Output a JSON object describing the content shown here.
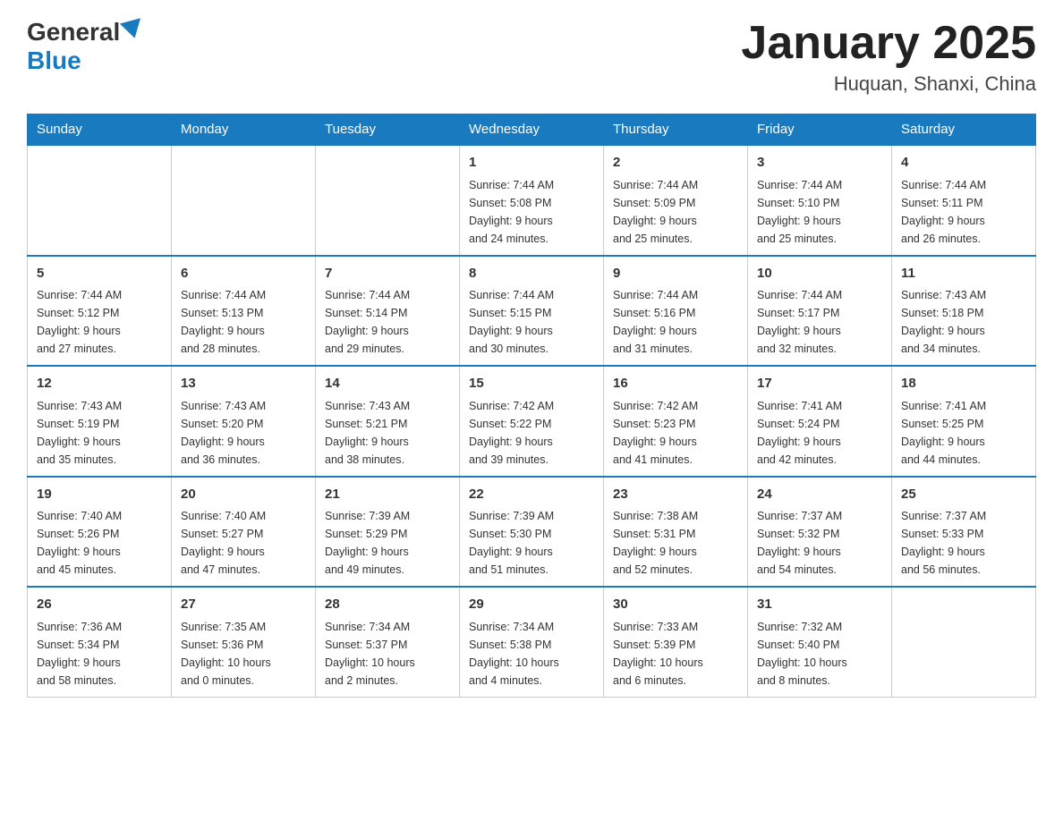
{
  "header": {
    "logo_general": "General",
    "logo_blue": "Blue",
    "month_title": "January 2025",
    "location": "Huquan, Shanxi, China"
  },
  "days_of_week": [
    "Sunday",
    "Monday",
    "Tuesday",
    "Wednesday",
    "Thursday",
    "Friday",
    "Saturday"
  ],
  "weeks": [
    [
      {
        "day": "",
        "info": ""
      },
      {
        "day": "",
        "info": ""
      },
      {
        "day": "",
        "info": ""
      },
      {
        "day": "1",
        "info": "Sunrise: 7:44 AM\nSunset: 5:08 PM\nDaylight: 9 hours\nand 24 minutes."
      },
      {
        "day": "2",
        "info": "Sunrise: 7:44 AM\nSunset: 5:09 PM\nDaylight: 9 hours\nand 25 minutes."
      },
      {
        "day": "3",
        "info": "Sunrise: 7:44 AM\nSunset: 5:10 PM\nDaylight: 9 hours\nand 25 minutes."
      },
      {
        "day": "4",
        "info": "Sunrise: 7:44 AM\nSunset: 5:11 PM\nDaylight: 9 hours\nand 26 minutes."
      }
    ],
    [
      {
        "day": "5",
        "info": "Sunrise: 7:44 AM\nSunset: 5:12 PM\nDaylight: 9 hours\nand 27 minutes."
      },
      {
        "day": "6",
        "info": "Sunrise: 7:44 AM\nSunset: 5:13 PM\nDaylight: 9 hours\nand 28 minutes."
      },
      {
        "day": "7",
        "info": "Sunrise: 7:44 AM\nSunset: 5:14 PM\nDaylight: 9 hours\nand 29 minutes."
      },
      {
        "day": "8",
        "info": "Sunrise: 7:44 AM\nSunset: 5:15 PM\nDaylight: 9 hours\nand 30 minutes."
      },
      {
        "day": "9",
        "info": "Sunrise: 7:44 AM\nSunset: 5:16 PM\nDaylight: 9 hours\nand 31 minutes."
      },
      {
        "day": "10",
        "info": "Sunrise: 7:44 AM\nSunset: 5:17 PM\nDaylight: 9 hours\nand 32 minutes."
      },
      {
        "day": "11",
        "info": "Sunrise: 7:43 AM\nSunset: 5:18 PM\nDaylight: 9 hours\nand 34 minutes."
      }
    ],
    [
      {
        "day": "12",
        "info": "Sunrise: 7:43 AM\nSunset: 5:19 PM\nDaylight: 9 hours\nand 35 minutes."
      },
      {
        "day": "13",
        "info": "Sunrise: 7:43 AM\nSunset: 5:20 PM\nDaylight: 9 hours\nand 36 minutes."
      },
      {
        "day": "14",
        "info": "Sunrise: 7:43 AM\nSunset: 5:21 PM\nDaylight: 9 hours\nand 38 minutes."
      },
      {
        "day": "15",
        "info": "Sunrise: 7:42 AM\nSunset: 5:22 PM\nDaylight: 9 hours\nand 39 minutes."
      },
      {
        "day": "16",
        "info": "Sunrise: 7:42 AM\nSunset: 5:23 PM\nDaylight: 9 hours\nand 41 minutes."
      },
      {
        "day": "17",
        "info": "Sunrise: 7:41 AM\nSunset: 5:24 PM\nDaylight: 9 hours\nand 42 minutes."
      },
      {
        "day": "18",
        "info": "Sunrise: 7:41 AM\nSunset: 5:25 PM\nDaylight: 9 hours\nand 44 minutes."
      }
    ],
    [
      {
        "day": "19",
        "info": "Sunrise: 7:40 AM\nSunset: 5:26 PM\nDaylight: 9 hours\nand 45 minutes."
      },
      {
        "day": "20",
        "info": "Sunrise: 7:40 AM\nSunset: 5:27 PM\nDaylight: 9 hours\nand 47 minutes."
      },
      {
        "day": "21",
        "info": "Sunrise: 7:39 AM\nSunset: 5:29 PM\nDaylight: 9 hours\nand 49 minutes."
      },
      {
        "day": "22",
        "info": "Sunrise: 7:39 AM\nSunset: 5:30 PM\nDaylight: 9 hours\nand 51 minutes."
      },
      {
        "day": "23",
        "info": "Sunrise: 7:38 AM\nSunset: 5:31 PM\nDaylight: 9 hours\nand 52 minutes."
      },
      {
        "day": "24",
        "info": "Sunrise: 7:37 AM\nSunset: 5:32 PM\nDaylight: 9 hours\nand 54 minutes."
      },
      {
        "day": "25",
        "info": "Sunrise: 7:37 AM\nSunset: 5:33 PM\nDaylight: 9 hours\nand 56 minutes."
      }
    ],
    [
      {
        "day": "26",
        "info": "Sunrise: 7:36 AM\nSunset: 5:34 PM\nDaylight: 9 hours\nand 58 minutes."
      },
      {
        "day": "27",
        "info": "Sunrise: 7:35 AM\nSunset: 5:36 PM\nDaylight: 10 hours\nand 0 minutes."
      },
      {
        "day": "28",
        "info": "Sunrise: 7:34 AM\nSunset: 5:37 PM\nDaylight: 10 hours\nand 2 minutes."
      },
      {
        "day": "29",
        "info": "Sunrise: 7:34 AM\nSunset: 5:38 PM\nDaylight: 10 hours\nand 4 minutes."
      },
      {
        "day": "30",
        "info": "Sunrise: 7:33 AM\nSunset: 5:39 PM\nDaylight: 10 hours\nand 6 minutes."
      },
      {
        "day": "31",
        "info": "Sunrise: 7:32 AM\nSunset: 5:40 PM\nDaylight: 10 hours\nand 8 minutes."
      },
      {
        "day": "",
        "info": ""
      }
    ]
  ]
}
